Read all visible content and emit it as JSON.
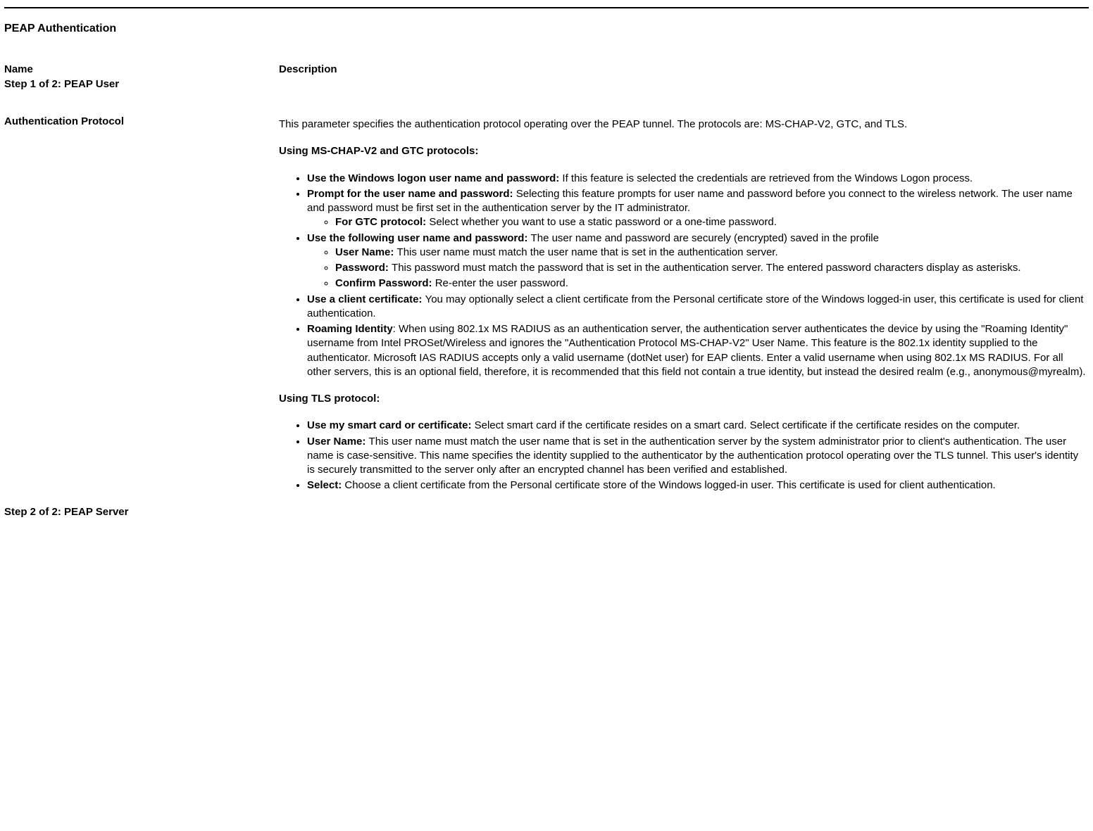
{
  "title": "PEAP Authentication",
  "headers": {
    "name": "Name",
    "desc": "Description"
  },
  "step1Label": "Step 1 of 2: PEAP User",
  "step2Label": "Step 2 of 2: PEAP Server",
  "authProtoLabel": "Authentication Protocol",
  "authProtoIntro": "This parameter specifies the authentication protocol operating over the PEAP tunnel. The protocols are: MS-CHAP-V2, GTC, and TLS.",
  "mschapHeader": "Using MS-CHAP-V2 and GTC protocols:",
  "li1b": "Use the Windows logon user name and password: ",
  "li1t": "If this feature is selected the credentials are retrieved from the Windows Logon process.",
  "li2b": "Prompt for the user name and password: ",
  "li2t": "Selecting this feature prompts for user name and password before you connect to the wireless network. The user name and password must be first set in the authentication server by the IT administrator.",
  "li2s1b": "For GTC protocol: ",
  "li2s1t": "Select whether you want to use a static password or a one-time password.",
  "li3b": "Use the following user name and password: ",
  "li3t": "The user name and password are securely (encrypted) saved in the profile",
  "li3s1b": "User Name: ",
  "li3s1t": "This user name must match the user name that is set in the authentication server.",
  "li3s2b": "Password: ",
  "li3s2t": "This password must match the password that is set in the authentication server. The entered password characters display as asterisks.",
  "li3s3b": "Confirm Password: ",
  "li3s3t": "Re-enter the user password.",
  "li4b": "Use a client certificate: ",
  "li4t": "You may optionally select a client certificate from the Personal certificate store of the Windows logged-in user, this certificate is used for client authentication.",
  "li5b": "Roaming Identity",
  "li5t": ": When using 802.1x MS RADIUS as an authentication server, the authentication server authenticates the device by using the \"Roaming Identity\" username from Intel PROSet/Wireless and ignores the \"Authentication Protocol MS-CHAP-V2\" User Name. This feature is the 802.1x identity supplied to the authenticator. Microsoft IAS RADIUS accepts only a valid username (dotNet user) for EAP clients. Enter a valid username when using 802.1x MS RADIUS. For all other servers, this is an optional field, therefore, it is recommended that this field not contain a true identity, but instead the desired realm (e.g., anonymous@myrealm).",
  "tlsHeader": "Using TLS protocol:",
  "tli1b": "Use my smart card or certificate: ",
  "tli1t": "Select smart card if the certificate resides on a smart card. Select certificate if the certificate resides on the computer.",
  "tli2b": "User Name: ",
  "tli2t": "This user name must match the user name that is set in the authentication server by the system administrator prior to client's authentication. The user name is case-sensitive. This name specifies the identity supplied to the authenticator by the authentication protocol operating over the TLS tunnel. This user's identity is securely transmitted to the server only after an encrypted channel has been verified and established.",
  "tli3b": "Select: ",
  "tli3t": "Choose a client certificate from the Personal certificate store of the Windows logged-in user. This certificate is used for client authentication."
}
